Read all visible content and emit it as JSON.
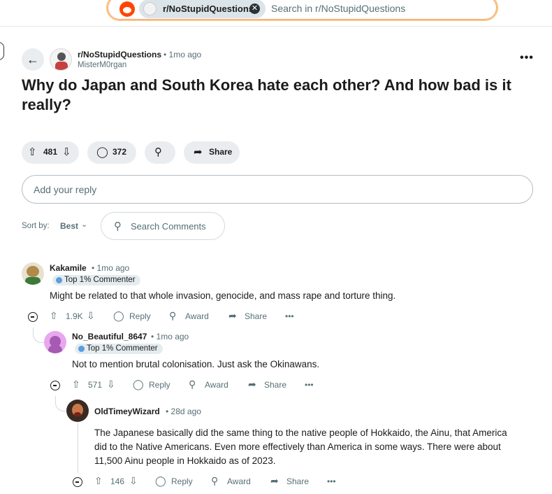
{
  "search": {
    "subreddit_chip": "r/NoStupidQuestions",
    "chip_close": "✕",
    "placeholder": "Search in r/NoStupidQuestions"
  },
  "post": {
    "subreddit": "r/NoStupidQuestions",
    "time": "• 1mo ago",
    "author": "MisterM0rgan",
    "title": "Why do Japan and South Korea hate each other? And how bad is it really?",
    "upvotes": "481",
    "comments": "372",
    "share_label": "Share",
    "more": "•••"
  },
  "reply": {
    "placeholder": "Add your reply"
  },
  "sort": {
    "label": "Sort by:",
    "value": "Best",
    "search_placeholder": "Search Comments"
  },
  "comments": [
    {
      "user": "Kakamile",
      "time": "• 1mo ago",
      "badge": "Top 1% Commenter",
      "text": "Might be related to that whole invasion, genocide, and mass rape and torture thing.",
      "votes": "1.9K",
      "reply": "Reply",
      "award": "Award",
      "share": "Share",
      "more": "•••"
    },
    {
      "user": "No_Beautiful_8647",
      "time": "• 1mo ago",
      "badge": "Top 1% Commenter",
      "text": "Not to mention brutal colonisation. Just ask the Okinawans.",
      "votes": "571",
      "reply": "Reply",
      "award": "Award",
      "share": "Share",
      "more": "•••"
    },
    {
      "user": "OldTimeyWizard",
      "time": "• 28d ago",
      "text_lines": [
        "The Japanese basically did the same thing to the native people of Hokkaido, the Ainu, that America",
        "did to the Native Americans. Even more effectively than America in some ways. There were about",
        "11,500 Ainu people in Hokkaido as of 2023."
      ],
      "votes": "146",
      "reply": "Reply",
      "award": "Award",
      "share": "Share",
      "more": "•••"
    }
  ]
}
